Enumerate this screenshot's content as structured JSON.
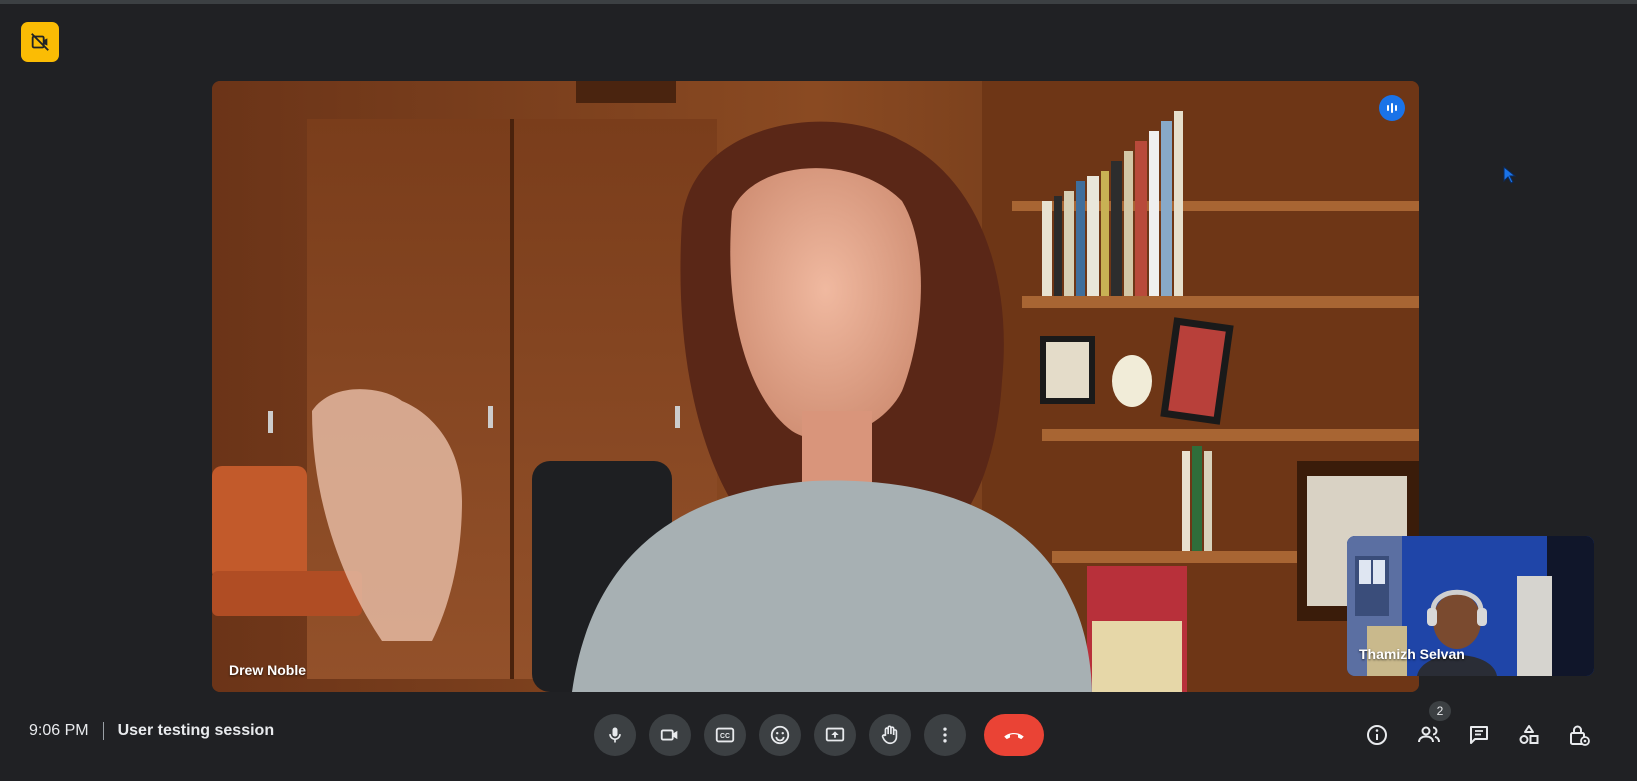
{
  "meeting": {
    "time": "9:06 PM",
    "title": "User testing session"
  },
  "main_participant": {
    "name": "Drew Noble",
    "speaking": true
  },
  "self_participant": {
    "name": "Thamizh Selvan"
  },
  "people_count": "2",
  "controls": [
    {
      "icon": "microphone-icon"
    },
    {
      "icon": "camera-icon"
    },
    {
      "icon": "captions-icon"
    },
    {
      "icon": "emoji-icon"
    },
    {
      "icon": "present-screen-icon"
    },
    {
      "icon": "raise-hand-icon"
    },
    {
      "icon": "more-options-icon"
    },
    {
      "icon": "end-call-icon"
    }
  ],
  "right_panel": [
    {
      "icon": "info-icon"
    },
    {
      "icon": "people-icon"
    },
    {
      "icon": "chat-icon"
    },
    {
      "icon": "activities-icon"
    },
    {
      "icon": "host-controls-icon"
    }
  ],
  "colors": {
    "background": "#202124",
    "control": "#3c4043",
    "end_call": "#ea4335",
    "badge": "#fbbc04",
    "accent": "#1a73e8"
  }
}
